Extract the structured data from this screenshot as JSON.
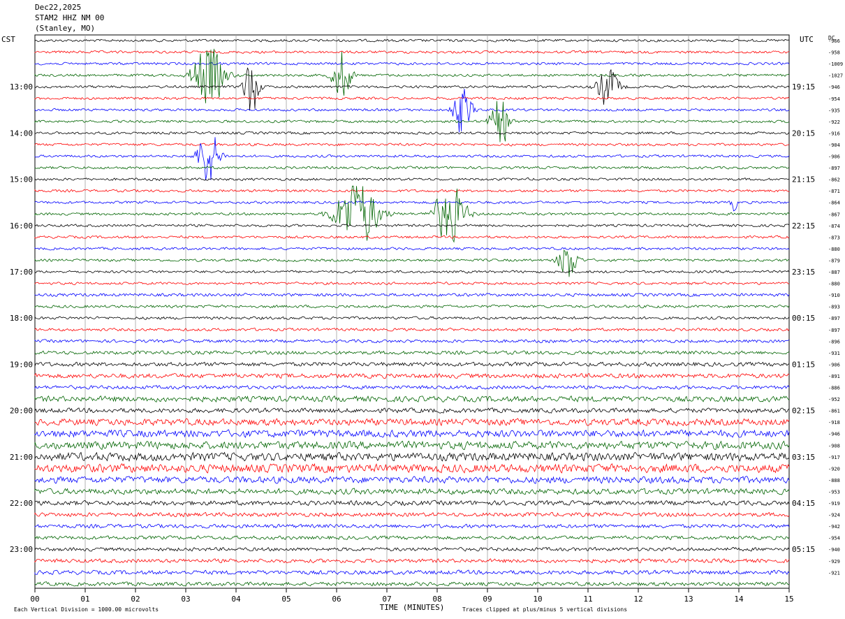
{
  "header": {
    "date": "Dec22,2025",
    "station": "STAM2 HHZ NM 00",
    "location": "(Stanley, MO)"
  },
  "labels": {
    "left_tz": "CST",
    "right_tz": "UTC",
    "dc": "DC"
  },
  "footer": {
    "scale_note": "Each Vertical Division = 1000.00 microvolts",
    "clip_note": "Traces clipped at plus/minus 5 vertical divisions"
  },
  "colors": {
    "black": "#000000",
    "red": "#ff0000",
    "blue": "#0000ff",
    "green": "#006400",
    "grid": "#a0a0a0"
  },
  "chart_data": {
    "type": "line",
    "xlabel": "TIME (MINUTES)",
    "xlim": [
      0,
      15
    ],
    "x_ticks": [
      "00",
      "01",
      "02",
      "03",
      "04",
      "05",
      "06",
      "07",
      "08",
      "09",
      "10",
      "11",
      "12",
      "13",
      "14",
      "15"
    ],
    "left_hour_labels": [
      "13:00",
      "14:00",
      "15:00",
      "16:00",
      "17:00",
      "18:00",
      "19:00",
      "20:00",
      "21:00",
      "22:00",
      "23:00"
    ],
    "right_hour_labels": [
      "19:15",
      "20:15",
      "21:15",
      "22:15",
      "23:15",
      "00:15",
      "01:15",
      "02:15",
      "03:15",
      "04:15",
      "05:15"
    ],
    "trace_color_cycle": [
      "black",
      "red",
      "blue",
      "green"
    ],
    "traces_count": 48,
    "dc_offsets": [
      "-966",
      "-958",
      "-1009",
      "-1027",
      "-946",
      "-954",
      "-935",
      "-922",
      "-916",
      "-904",
      "-906",
      "-897",
      "-862",
      "-871",
      "-864",
      "-867",
      "-874",
      "-873",
      "-880",
      "-879",
      "-887",
      "-880",
      "-910",
      "-893",
      "-897",
      "-897",
      "-896",
      "-931",
      "-906",
      "-891",
      "-886",
      "-952",
      "-861",
      "-918",
      "-946",
      "-908",
      "-917",
      "-920",
      "-888",
      "-953",
      "-919",
      "-924",
      "-942",
      "-954",
      "-940",
      "-929",
      "-921"
    ],
    "trace_noise_level": [
      1,
      1,
      1,
      1,
      1,
      1,
      1,
      1,
      1,
      1,
      1,
      1,
      1,
      1,
      1,
      1,
      1,
      1,
      1,
      1,
      1,
      1,
      1.2,
      1.1,
      1.1,
      1.1,
      1.2,
      1.4,
      1.6,
      1.8,
      1.4,
      2.2,
      1.8,
      2.6,
      2.8,
      3.0,
      3.2,
      3.3,
      2.6,
      2.2,
      1.8,
      1.6,
      1.5,
      1.4,
      1.4,
      1.5,
      1.6,
      1.5
    ],
    "events": [
      {
        "trace": 3,
        "minute": 3.45,
        "amplitude": 7,
        "duration_min": 1.0
      },
      {
        "trace": 4,
        "minute": 4.3,
        "amplitude": 6,
        "duration_min": 0.5
      },
      {
        "trace": 3,
        "minute": 6.1,
        "amplitude": 5,
        "duration_min": 0.6
      },
      {
        "trace": 6,
        "minute": 8.5,
        "amplitude": 5,
        "duration_min": 0.6
      },
      {
        "trace": 7,
        "minute": 9.25,
        "amplitude": 5,
        "duration_min": 0.6
      },
      {
        "trace": 4,
        "minute": 11.4,
        "amplitude": 4,
        "duration_min": 0.7
      },
      {
        "trace": 10,
        "minute": 3.45,
        "amplitude": 6,
        "duration_min": 0.7
      },
      {
        "trace": 15,
        "minute": 6.4,
        "amplitude": 7,
        "duration_min": 1.4
      },
      {
        "trace": 15,
        "minute": 8.25,
        "amplitude": 6,
        "duration_min": 1.0
      },
      {
        "trace": 19,
        "minute": 10.6,
        "amplitude": 4,
        "duration_min": 0.6
      },
      {
        "trace": 14,
        "minute": 13.9,
        "amplitude": 1.5,
        "duration_min": 0.2
      }
    ]
  }
}
